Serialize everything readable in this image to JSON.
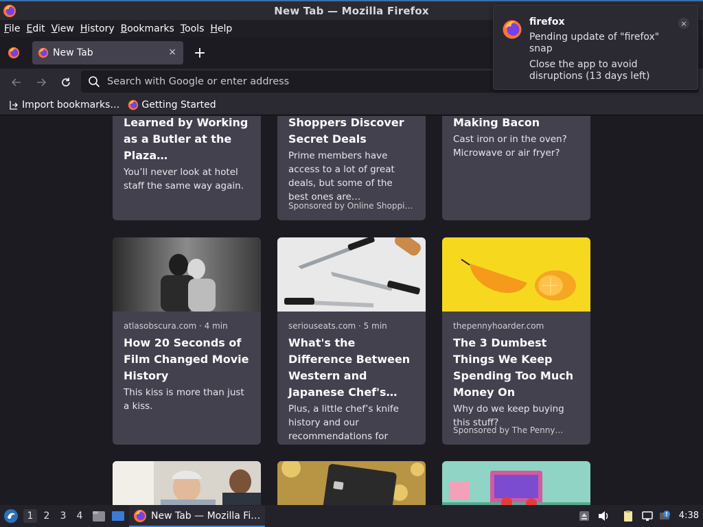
{
  "window": {
    "title": "New Tab — Mozilla Firefox"
  },
  "menu": [
    "File",
    "Edit",
    "View",
    "History",
    "Bookmarks",
    "Tools",
    "Help"
  ],
  "menu_mnemonics": [
    "F",
    "E",
    "V",
    "H",
    "B",
    "T",
    "H"
  ],
  "tab": {
    "title": "New Tab",
    "close_glyph": "×"
  },
  "new_tab_glyph": "+",
  "urlbar": {
    "placeholder": "Search with Google or enter address"
  },
  "bookmarks": [
    {
      "label": "Import bookmarks…",
      "icon": "import-icon"
    },
    {
      "label": "Getting Started",
      "icon": "firefox-icon"
    }
  ],
  "cards_top": [
    {
      "headline": "Learned by Working as a Butler at the Plaza…",
      "excerpt": "You’ll never look at hotel staff the same way again.",
      "sponsor": ""
    },
    {
      "headline": "Shoppers Discover Secret Deals",
      "excerpt": "Prime members have access to a lot of great deals, but some of the best ones are…",
      "sponsor": "Sponsored by Online Shoppi…"
    },
    {
      "headline": "Making Bacon",
      "excerpt": "Cast iron or in the oven? Microwave or air fryer?",
      "sponsor": ""
    }
  ],
  "cards_middle": [
    {
      "source": "atlasobscura.com · 4 min",
      "headline": "How 20 Seconds of Film Changed Movie History",
      "excerpt": "This kiss is more than just a kiss.",
      "sponsor": "",
      "thumb": "black-and-white-kiss-photo"
    },
    {
      "source": "seriouseats.com · 5 min",
      "headline": "What's the Difference Between Western and Japanese Chef's…",
      "excerpt": "Plus, a little chef’s knife history and our recommendations for bot…",
      "sponsor": "",
      "thumb": "chef-knives-photo"
    },
    {
      "source": "thepennyhoarder.com",
      "headline": "The 3 Dumbest Things We Keep Spending Too Much Money On",
      "excerpt": "Why do we keep buying this stuff?",
      "sponsor": "Sponsored by The Penny…",
      "thumb": "sliced-orange-photo"
    }
  ],
  "notification": {
    "app": "firefox",
    "line1": "Pending update of \"firefox\" snap",
    "line2": "Close the app to avoid disruptions (13 days left)",
    "close_glyph": "×"
  },
  "taskbar": {
    "workspaces": [
      "1",
      "2",
      "3",
      "4"
    ],
    "active_workspace": "1",
    "task_label": "New Tab — Mozilla Fi…",
    "clock": "4:38"
  },
  "colors": {
    "accent": "#3a8ad8",
    "card_bg": "#42414d",
    "page_bg": "#1c1b22",
    "toolbar_bg": "#2b2a33"
  }
}
